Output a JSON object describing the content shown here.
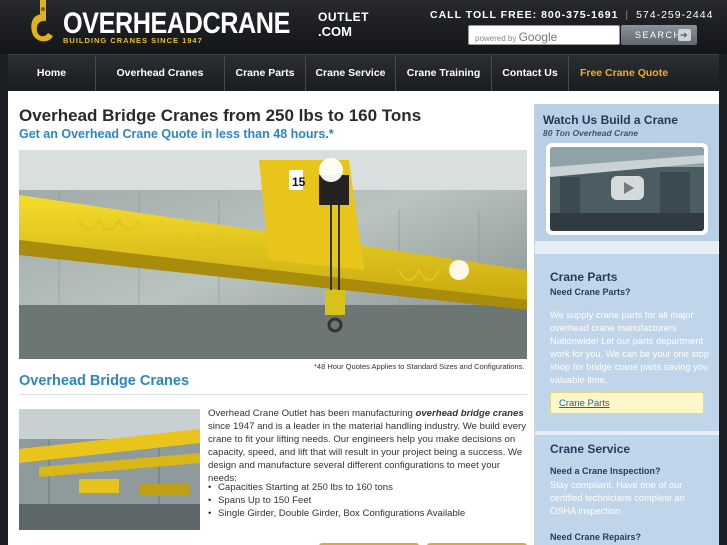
{
  "header": {
    "logo_main": "OVERHEADCRANE",
    "logo_outlet": "OUTLET",
    "logo_com": ".COM",
    "logo_tagline": "BUILDING CRANES SINCE 1947",
    "toll_label": "CALL TOLL FREE: 800-375-1691",
    "toll_sep": "|",
    "alt_phone": "574-259-2444",
    "search_powered": "powered by",
    "search_brand": "Google",
    "search_button": "SEARCH"
  },
  "nav": {
    "items": [
      "Home",
      "Overhead Cranes",
      "Crane Parts",
      "Crane Service",
      "Crane Training",
      "Contact Us",
      "Free Crane Quote"
    ]
  },
  "main": {
    "title": "Overhead Bridge Cranes from 250 lbs to 160 Tons",
    "subtitle": "Get an Overhead Crane Quote in less than 48 hours.*",
    "hero_caption": "*48 Hour Quotes Applies to Standard Sizes and Configurations.",
    "section_title": "Overhead Bridge Cranes",
    "para_pre": "Overhead Crane Outlet has been manufacturing ",
    "para_bold": "overhead bridge cranes",
    "para_post": " since 1947 and is a leader in the material handling industry. We build every crane to fit your lifting needs. Our engineers help you make decisions on capacity, speed, and lift that will result in your project being a success. We design and manufacture several different configurations to meet your needs:",
    "bullets": [
      "Capacities Starting at 250 lbs to 160 tons",
      "Spans Up to 150 Feet",
      "Single Girder, Double Girder, Box Configurations Available"
    ]
  },
  "sidebar": {
    "watch_title": "Watch Us Build a Crane",
    "watch_sub": "80 Ton Overhead Crane",
    "parts_title": "Crane Parts",
    "parts_sub": "Need Crane Parts?",
    "parts_text": "We supply crane parts for all major overhead crane manufacturers Nationwide! Let our parts department work for you. We can be your one stop shop for bridge crane parts saving you valuable time.",
    "parts_button": "Crane Parts",
    "service_title": "Crane Service",
    "service_sub1": "Need a Crane Inspection?",
    "service_text": "Stay compliant. Have one of our certified technicians complete an OSHA inspection.",
    "service_sub2": "Need Crane Repairs?"
  },
  "colors": {
    "accent_blue": "#2b86c9",
    "quote_orange": "#f2b01e",
    "crane_yellow": "#e7c024",
    "sidebar_blue": "#b8cfe6"
  },
  "icons": {
    "logo": "crane-hook-icon",
    "search_arrow": "arrow-right-icon",
    "video": "play-icon"
  }
}
